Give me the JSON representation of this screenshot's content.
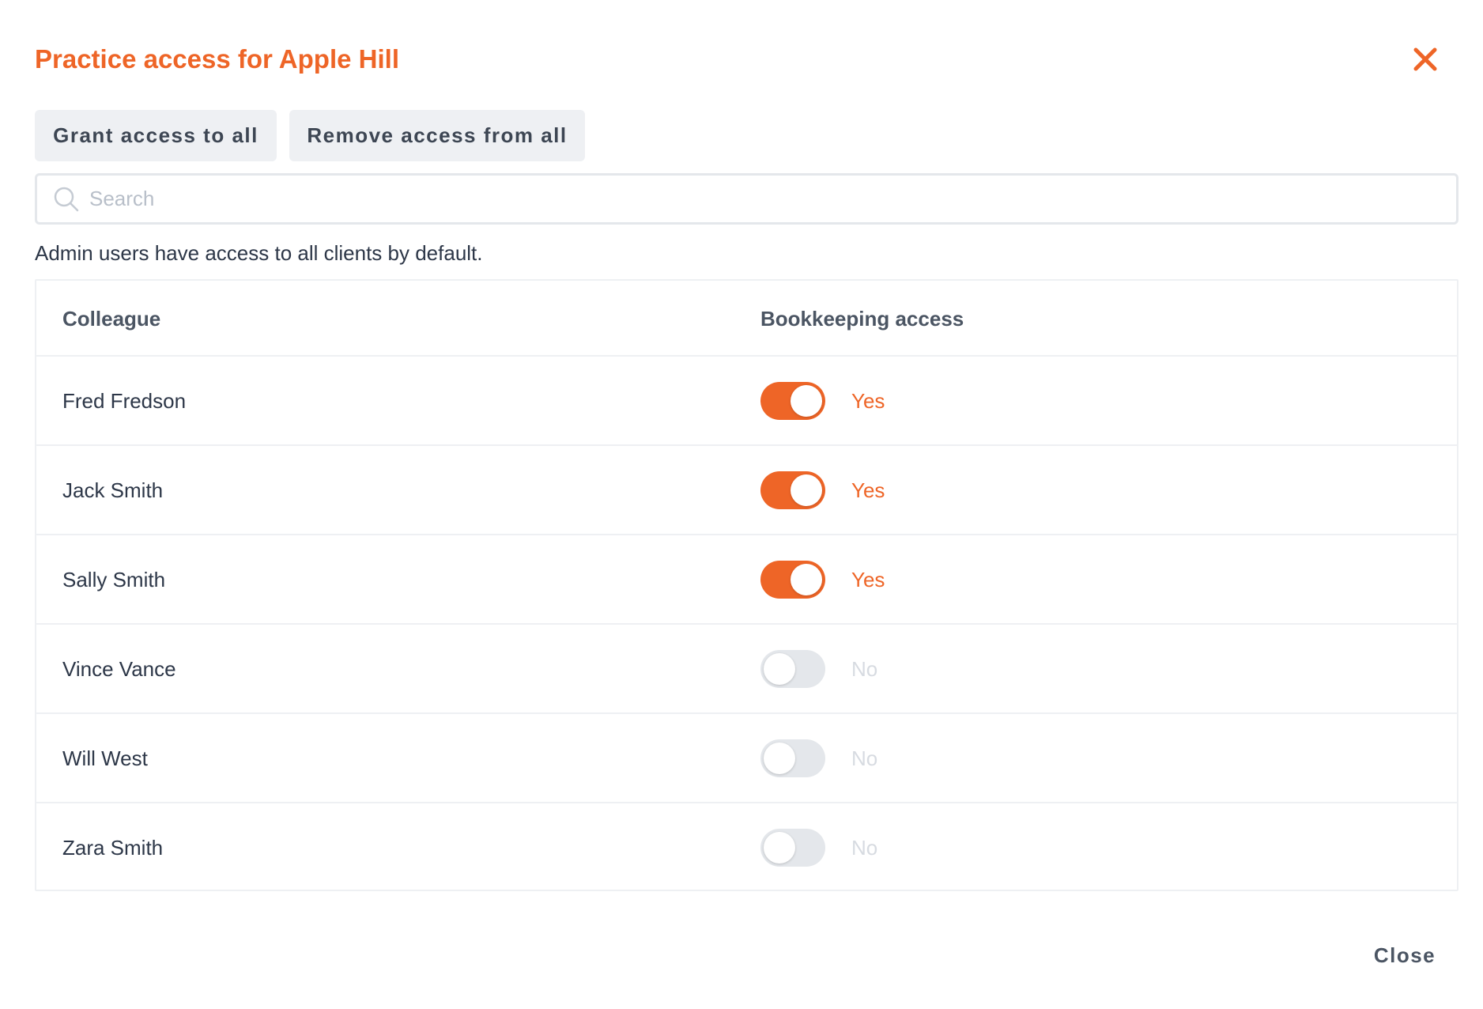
{
  "dialog": {
    "title": "Practice access for Apple Hill",
    "close_icon": "close-icon",
    "accent_color": "#ee6527"
  },
  "actions": {
    "grant_all_label": "Grant access to all",
    "remove_all_label": "Remove access from all"
  },
  "search": {
    "placeholder": "Search",
    "value": "",
    "icon": "search-icon"
  },
  "info_text": "Admin users have access to all clients by default.",
  "table": {
    "headers": {
      "colleague": "Colleague",
      "access": "Bookkeeping access"
    },
    "rows": [
      {
        "name": "Fred Fredson",
        "access": true,
        "status": "Yes"
      },
      {
        "name": "Jack Smith",
        "access": true,
        "status": "Yes"
      },
      {
        "name": "Sally Smith",
        "access": true,
        "status": "Yes"
      },
      {
        "name": "Vince Vance",
        "access": false,
        "status": "No"
      },
      {
        "name": "Will West",
        "access": false,
        "status": "No"
      },
      {
        "name": "Zara Smith",
        "access": false,
        "status": "No"
      }
    ]
  },
  "footer": {
    "close_label": "Close"
  }
}
